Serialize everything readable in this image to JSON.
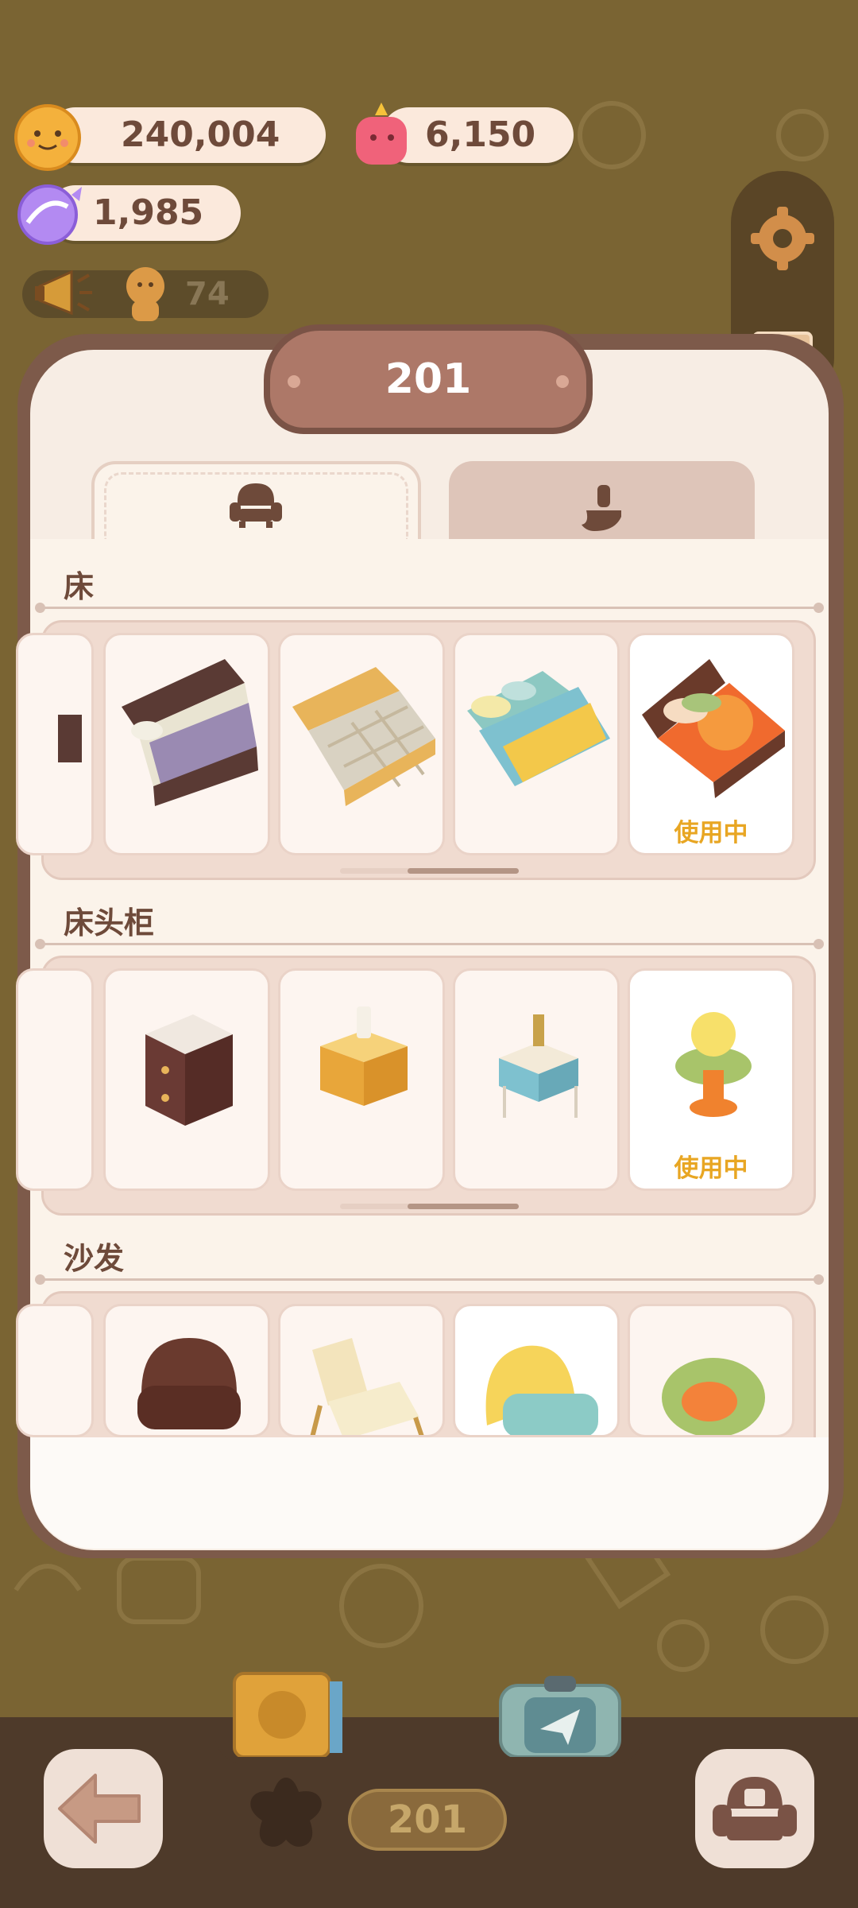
{
  "currencies": {
    "cookies": "240,004",
    "jelly": "6,150",
    "candy": "1,985"
  },
  "ticker": {
    "count": "74"
  },
  "panel": {
    "room_title": "201",
    "tabs": [
      {
        "icon": "armchair-icon",
        "selected": true
      },
      {
        "icon": "paint-brush-icon",
        "selected": false
      }
    ]
  },
  "sections": {
    "bed": {
      "title": "床",
      "in_use_label": "使用中"
    },
    "nightstand": {
      "title": "床头柜",
      "in_use_label": "使用中"
    },
    "sofa": {
      "title": "沙发"
    }
  },
  "bottom": {
    "room_number": "201"
  },
  "colors": {
    "background": "#7a6433",
    "panel": "#f7ede4",
    "accent_in_use": "#e8a623",
    "plaque": "#ad7868"
  }
}
